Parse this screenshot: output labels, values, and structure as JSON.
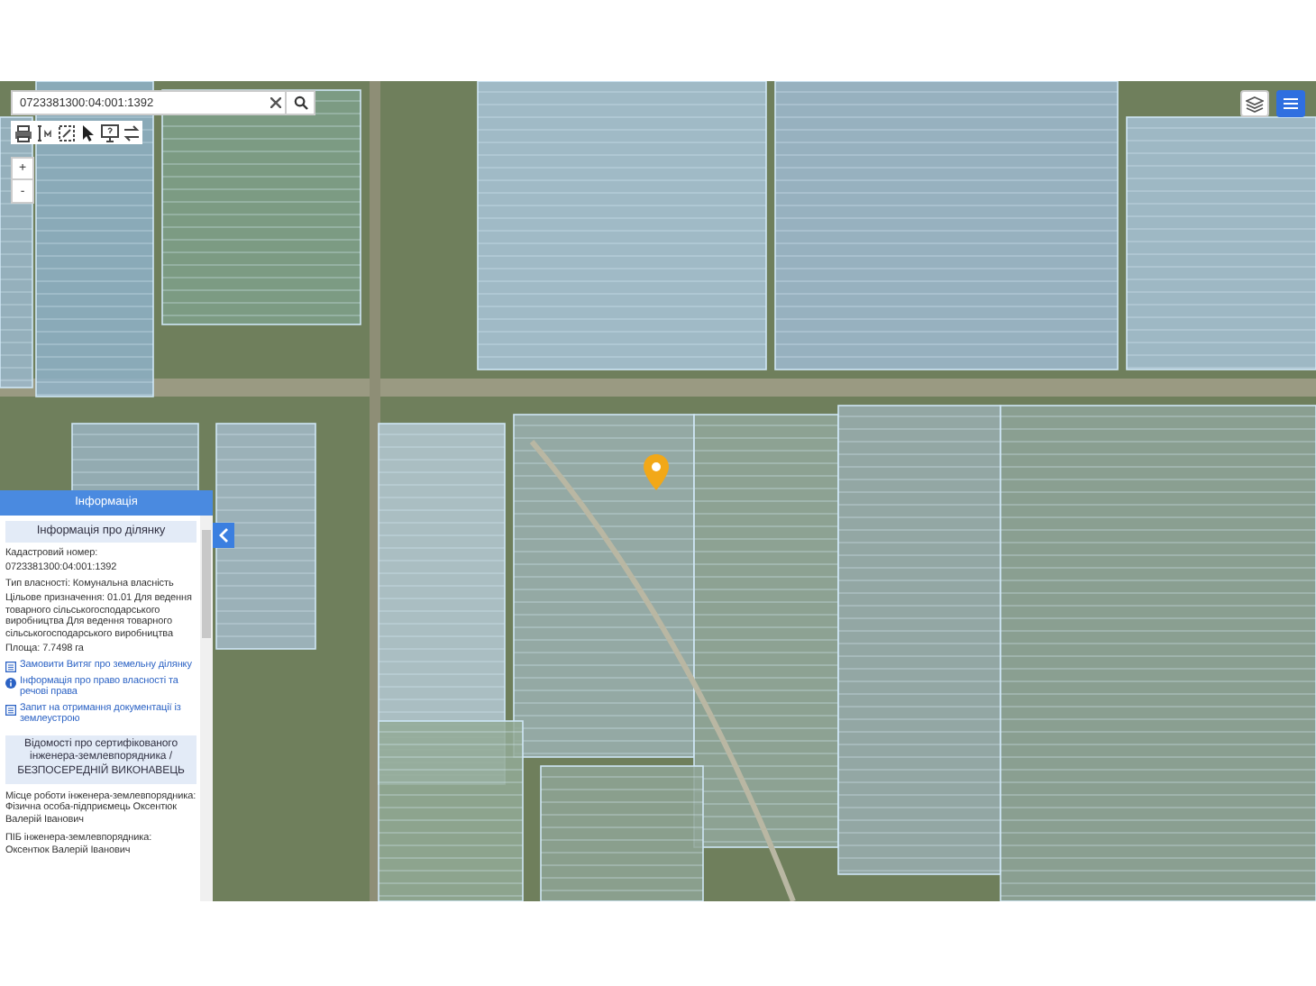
{
  "search": {
    "value": "0723381300:04:001:1392"
  },
  "zoom_buttons": [
    "+",
    "-"
  ],
  "info_panel": {
    "title": "Інформація",
    "section_title": "Інформація про ділянку",
    "fields": [
      "Кадастровий номер:",
      "0723381300:04:001:1392",
      "Тип власності: Комунальна власність",
      "Цільове призначення: 01.01 Для ведення товарного сільськогосподарського виробництва Для ведення товарного сільськогосподарського виробництва",
      "Площа: 7.7498 га"
    ],
    "links": [
      {
        "kind": "document",
        "text": "Замовити Витяг про земельну ділянку"
      },
      {
        "kind": "info",
        "text": "Інформація про право власності та речові права"
      },
      {
        "kind": "document",
        "text": "Запит на отримання документації із землеустрою"
      }
    ],
    "engineer_title": "Відомості про сертифікованого інженера-землевпорядника / БЕЗПОСЕРЕДНІЙ ВИКОНАВЕЦЬ",
    "engineer_fields": [
      "Місце роботи інженера-землевпорядника: Фізична особа-підприємець Оксентюк Валерій Іванович",
      "ПІБ інженера-землевпорядника: Оксентюк Валерій Іванович"
    ]
  }
}
